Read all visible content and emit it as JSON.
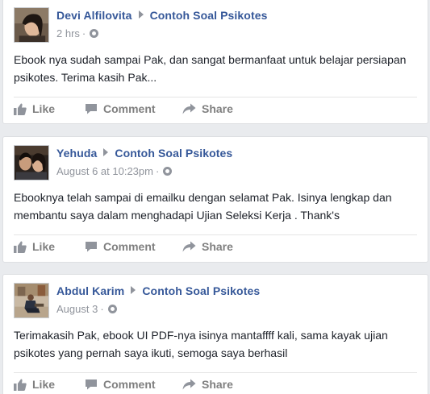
{
  "posts": [
    {
      "author": "Devi Alfilovita",
      "target": "Contoh Soal Psikotes",
      "time": "2 hrs",
      "dot": "·",
      "text": "Ebook nya sudah sampai Pak, dan sangat bermanfaat untuk belajar persiapan psikotes. Terima kasih Pak...",
      "actions": {
        "like": "Like",
        "comment": "Comment",
        "share": "Share"
      }
    },
    {
      "author": "Yehuda",
      "target": "Contoh Soal Psikotes",
      "time": "August 6 at 10:23pm",
      "dot": "·",
      "text": "Ebooknya telah sampai di emailku dengan selamat Pak. Isinya lengkap dan membantu saya dalam menghadapi Ujian Seleksi Kerja . Thank's",
      "actions": {
        "like": "Like",
        "comment": "Comment",
        "share": "Share"
      }
    },
    {
      "author": "Abdul Karim",
      "target": "Contoh Soal Psikotes",
      "time": "August 3",
      "dot": "·",
      "text": "Terimakasih Pak, ebook UI PDF-nya isinya mantaffff kali, sama kayak ujian psikotes yang pernah saya ikuti, semoga saya berhasil",
      "actions": {
        "like": "Like",
        "comment": "Comment",
        "share": "Share"
      }
    }
  ],
  "colors": {
    "author": "#365899",
    "meta": "#90949c",
    "body_text": "#1d2129",
    "action_text": "#7f7f7f",
    "background": "#e9ebee"
  }
}
